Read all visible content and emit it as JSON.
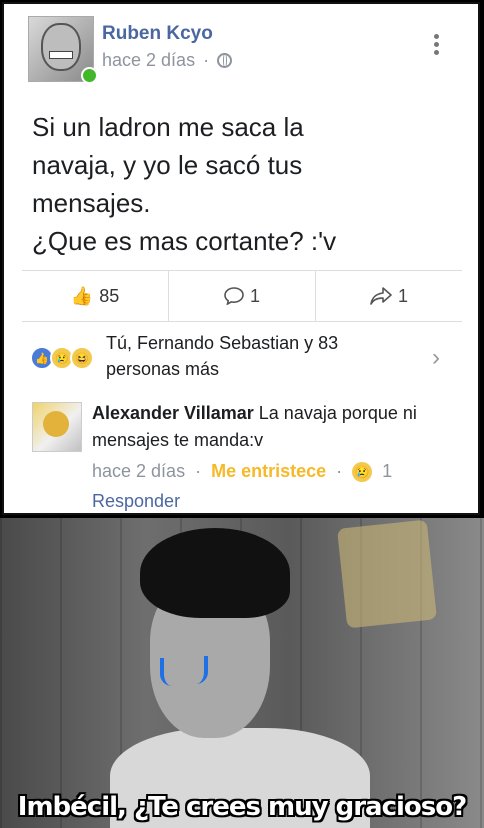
{
  "post": {
    "author": "Ruben Kcyo",
    "time": "hace 2 días",
    "separator": "·",
    "text_lines": [
      "Si un ladron me saca la",
      "navaja, y yo le sacó tus",
      "mensajes.",
      "¿Que es mas cortante? :'v"
    ],
    "likes": "85",
    "comments": "1",
    "shares": "1",
    "reactions_text": "Tú, Fernando Sebastian y 83 personas más"
  },
  "comment": {
    "author": "Alexander Villamar",
    "text": "La navaja porque ni mensajes te manda:v",
    "time": "hace 2 días",
    "separator": "·",
    "reaction_link": "Me entristece",
    "reaction_count": "1",
    "reply_label": "Responder"
  },
  "meme": {
    "caption": "Imbécil, ¿Te crees muy gracioso?"
  },
  "colors": {
    "link_blue": "#4b67a1",
    "sad_reaction": "#f7b928",
    "tear_blue": "#1f6fe5"
  }
}
